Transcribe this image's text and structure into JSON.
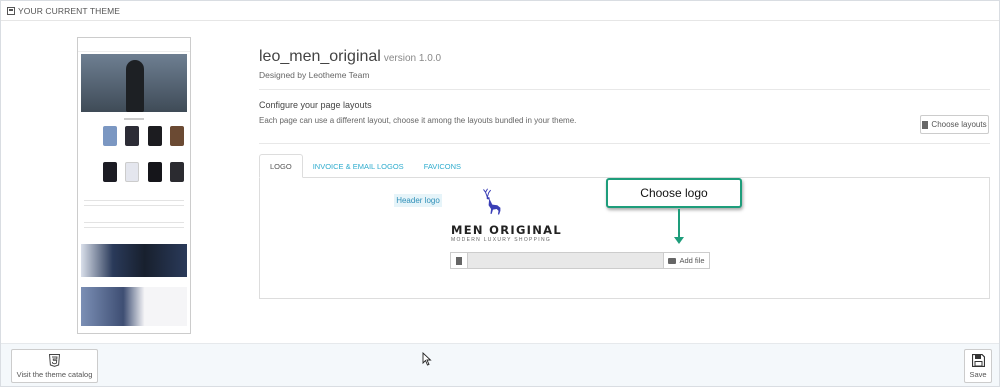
{
  "panel": {
    "heading": "YOUR CURRENT THEME"
  },
  "theme": {
    "name": "leo_men_original",
    "version": "version 1.0.0",
    "designed_by": "Designed by Leotheme Team"
  },
  "layouts": {
    "title": "Configure your page layouts",
    "description": "Each page can use a different layout, choose it among the layouts bundled in your theme.",
    "button_label": "Choose layouts"
  },
  "tabs": [
    {
      "label": "LOGO",
      "active": true
    },
    {
      "label": "INVOICE & EMAIL LOGOS",
      "active": false
    },
    {
      "label": "FAVICONS",
      "active": false
    }
  ],
  "logo_tab": {
    "header_logo_label": "Header logo",
    "logo_text": "MEN ORIGINAL",
    "logo_tagline": "MODERN LUXURY SHOPPING",
    "add_file_label": "Add file"
  },
  "callout": {
    "text": "Choose logo"
  },
  "footer": {
    "catalog_label": "Visit the theme catalog",
    "save_label": "Save"
  },
  "colors": {
    "accent": "#2eacce",
    "callout_border": "#1e9d7b",
    "logo_deer": "#3b3fb6"
  }
}
